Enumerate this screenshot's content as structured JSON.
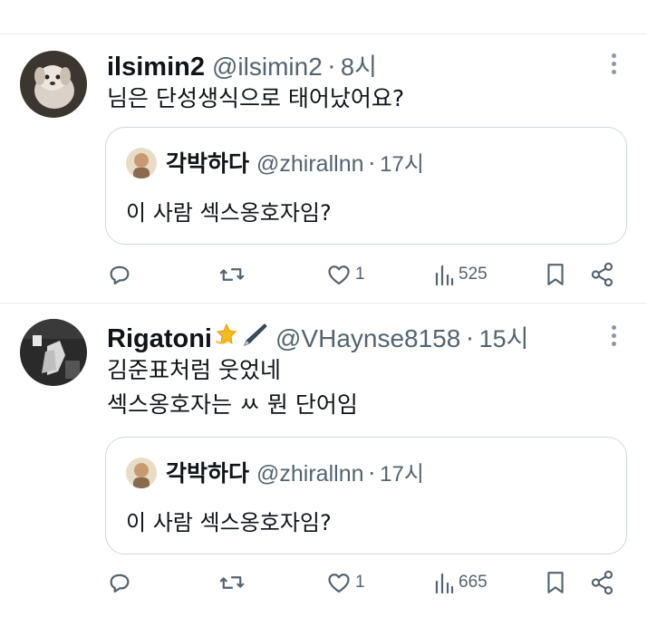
{
  "tweets": [
    {
      "name": "ilsimin2",
      "handle": "@ilsimin2",
      "separator": "·",
      "time": "8시",
      "text_lines": [
        "님은 단성생식으로 태어났어요?"
      ],
      "quote": {
        "name": "각박하다",
        "handle": "@zhirallnn",
        "separator": "·",
        "time": "17시",
        "text": "이 사람 섹스옹호자임?"
      },
      "stats": {
        "likes": "1",
        "views": "525"
      }
    },
    {
      "name": "Rigatoni",
      "name_emojis": [
        "dizzy-icon",
        "pen-icon"
      ],
      "handle": "@VHaynse8158",
      "separator": "·",
      "time": "15시",
      "text_lines": [
        "김준표처럼 웃었네",
        "섹스옹호자는 ㅆ 뭔 단어임"
      ],
      "quote": {
        "name": "각박하다",
        "handle": "@zhirallnn",
        "separator": "·",
        "time": "17시",
        "text": "이 사람 섹스옹호자임?"
      },
      "stats": {
        "likes": "1",
        "views": "665"
      }
    }
  ],
  "colors": {
    "text": "#0f1419",
    "secondary": "#536471",
    "border": "#cfd9de",
    "divider": "#e7e9ea"
  }
}
